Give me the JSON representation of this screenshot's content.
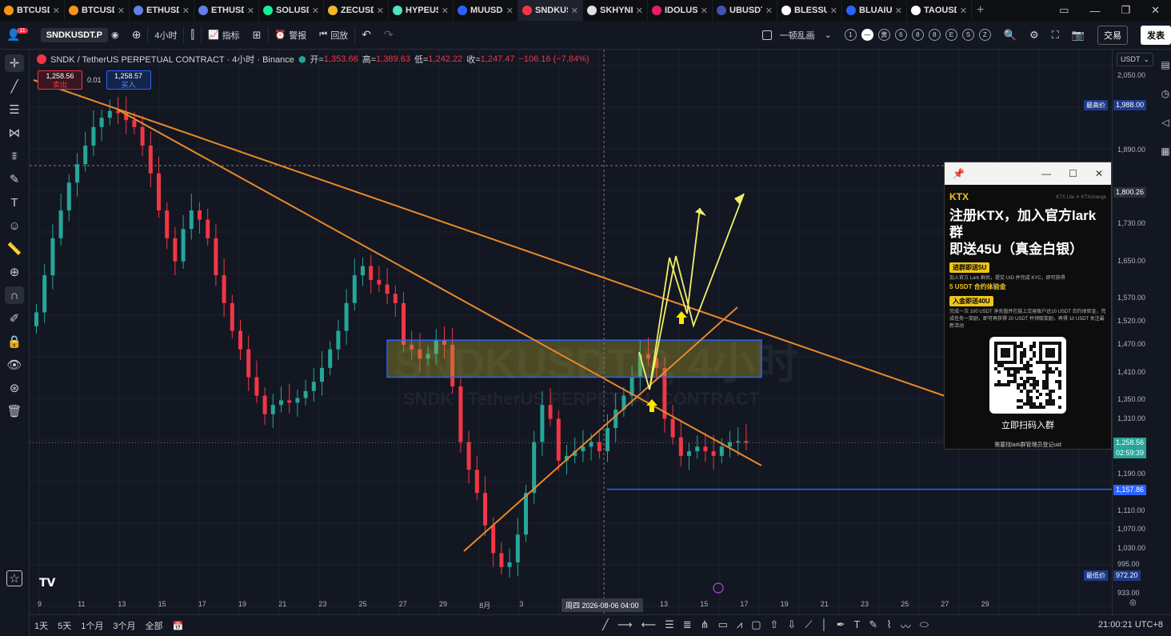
{
  "tabs": [
    {
      "label": "BTCUSD",
      "color": "#f7931a"
    },
    {
      "label": "BTCUSD",
      "color": "#f7931a"
    },
    {
      "label": "ETHUSD",
      "color": "#627eea"
    },
    {
      "label": "ETHUSD",
      "color": "#627eea"
    },
    {
      "label": "SOLUSD",
      "color": "#14f195"
    },
    {
      "label": "ZECUSD",
      "color": "#f4b728"
    },
    {
      "label": "HYPEUS",
      "color": "#50e3c2"
    },
    {
      "label": "MUUSD",
      "color": "#2962ff"
    },
    {
      "label": "SNDKUS",
      "color": "#f23645",
      "active": true
    },
    {
      "label": "SKHYNI",
      "color": "#e0e0e0"
    },
    {
      "label": "IDOLUS",
      "color": "#e91e63"
    },
    {
      "label": "UBUSDT",
      "color": "#3f51b5"
    },
    {
      "label": "BLESSU",
      "color": "#ffffff"
    },
    {
      "label": "BLUAIU",
      "color": "#2962ff"
    },
    {
      "label": "TAOUSD",
      "color": "#ffffff"
    }
  ],
  "toolbar": {
    "notif_count": "11",
    "symbol": "SNDKUSDT.P",
    "interval": "4小时",
    "indicators": "指标",
    "alert": "警报",
    "replay": "回放",
    "layout_name": "一顿乱画",
    "timeframe_circles": [
      "1",
      "—",
      "黄",
      "6",
      "8",
      "8",
      "E",
      "S",
      "Z"
    ],
    "trade": "交易",
    "publish": "发表"
  },
  "legend": {
    "title": "SNDK / TetherUS PERPETUAL CONTRACT · 4小时 · Binance",
    "open_label": "开=",
    "open": "1,353.66",
    "high_label": "高=",
    "high": "1,389.63",
    "low_label": "低=",
    "low": "1,242.22",
    "close_label": "收=",
    "close": "1,247.47",
    "change": "−106.16 (−7.84%)",
    "sell_price": "1,258.56",
    "sell_label": "卖出",
    "spread": "0.01",
    "buy_price": "1,258.57",
    "buy_label": "买入"
  },
  "watermark": {
    "big": "SNDKUSDT.P, 4小时",
    "small": "SNDK / TetherUS PERPETUAL CONTRACT"
  },
  "price_axis": {
    "currency": "USDT",
    "labels": [
      "2,050.00",
      "1,988.00",
      "1,890.00",
      "1,800.26",
      "1,730.00",
      "1,650.00",
      "1,570.00",
      "1,520.00",
      "1,470.00",
      "1,410.00",
      "1,350.00",
      "1,310.00",
      "1,258.56",
      "1,190.00",
      "1,157.86",
      "1,110.00",
      "1,070.00",
      "1,030.00",
      "995.00",
      "972.20",
      "933.00"
    ],
    "highest_label": "最高价",
    "lowest_label": "最低价",
    "countdown": "02:59:39"
  },
  "time_axis": {
    "labels": [
      "9",
      "11",
      "13",
      "15",
      "17",
      "19",
      "21",
      "23",
      "25",
      "27",
      "29",
      "8月",
      "3",
      "9",
      "11",
      "13",
      "15",
      "17",
      "19",
      "21",
      "23",
      "25",
      "27",
      "29"
    ],
    "crosshair": "周四 2026-08-06  04:00"
  },
  "ad": {
    "brand": "KTX",
    "brand_side": "KTX Lite   ✕ KTXchange",
    "title_line1": "注册KTX，加入官方lark群",
    "title_line2": "即送45U（真金白银）",
    "tag1": "进群即送5U",
    "text1": "加入官方 Lark 群后，提交 UID 并完成 KYC，即可获得",
    "hl1": "5 USDT 合约体验金",
    "tag2": "入金即送40U",
    "text2": "完成一次 100 USDT 净充值并在链上交易账户达10 USDT 合约体验金，完成任务一奖励，即可再获得 20 USDT 并领取奖励，再得 10 USDT 关注最新活动",
    "cta": "立即扫码入群",
    "footer": "需要找lark群管理员登记uid"
  },
  "bottom": {
    "ranges": [
      "1天",
      "5天",
      "1个月",
      "3个月",
      "全部"
    ],
    "clock": "21:00:21 UTC+8"
  },
  "chart_data": {
    "type": "candlestick",
    "title": "SNDK / TetherUS PERPETUAL CONTRACT · 4小时 · Binance",
    "ylim": [
      905,
      2090
    ],
    "ohlc_last": {
      "open": 1353.66,
      "high": 1389.63,
      "low": 1242.22,
      "close": 1247.47
    },
    "current_price": 1258.56,
    "period_high": 1988.0,
    "period_low": 972.2,
    "horizontal_line": 1157.86,
    "zone": [
      1400,
      1480
    ],
    "series": [
      {
        "close": [
          1540,
          1620,
          1700,
          1760,
          1820,
          1860,
          1900,
          1940,
          1960,
          1975,
          1970,
          1955,
          1940,
          1900,
          1840,
          1760,
          1700,
          1650,
          1720,
          1760,
          1740,
          1700,
          1620,
          1560,
          1500,
          1460,
          1400,
          1360,
          1320,
          1340,
          1350,
          1345,
          1355,
          1370,
          1390,
          1420,
          1460,
          1500,
          1560,
          1620,
          1640,
          1610,
          1600,
          1580,
          1560,
          1470,
          1460,
          1440,
          1450,
          1480,
          1470,
          1380,
          1260,
          1200,
          1150,
          1080,
          1020,
          990,
          1000,
          1060,
          1150,
          1260,
          1340,
          1310,
          1220,
          1230,
          1240,
          1250,
          1260,
          1240,
          1290,
          1330,
          1360,
          1400,
          1450,
          1440,
          1420,
          1310,
          1270,
          1230,
          1240,
          1250,
          1240,
          1230,
          1250,
          1260,
          1262,
          1258
        ]
      }
    ]
  }
}
